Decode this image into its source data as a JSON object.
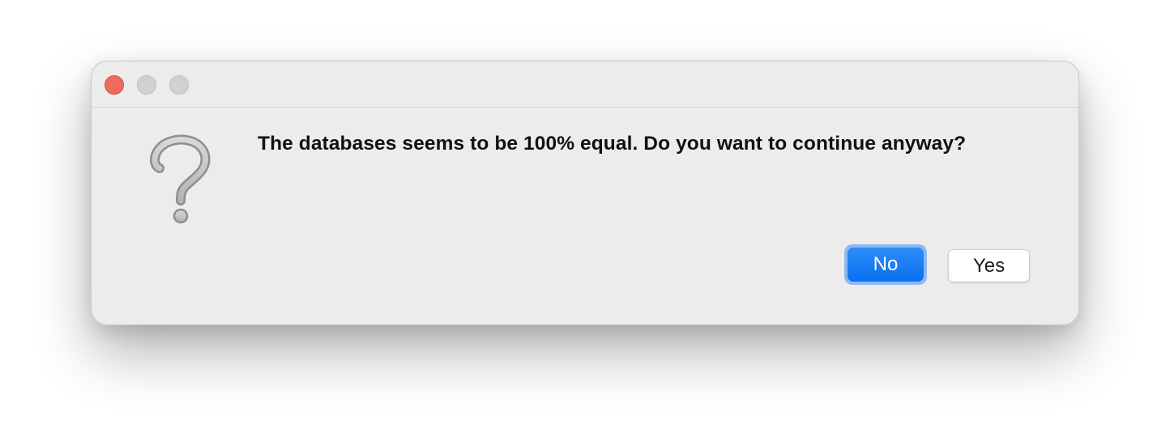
{
  "dialog": {
    "message": "The databases seems to be 100% equal. Do you want to continue anyway?",
    "icon": "question-mark-icon",
    "buttons": {
      "no_label": "No",
      "yes_label": "Yes"
    }
  },
  "window_controls": [
    "close",
    "minimize",
    "zoom"
  ],
  "colors": {
    "close": "#ed6a5e",
    "inactive_control": "#d1d1d1",
    "primary_button": "#0a6ff0",
    "focus_ring": "#8db8f2",
    "window_background": "#ececec"
  }
}
